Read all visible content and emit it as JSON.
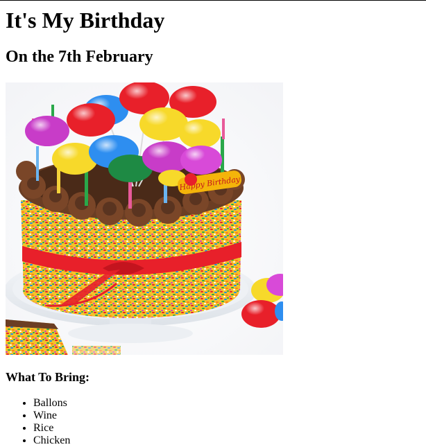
{
  "page": {
    "title": "It's My Birthday",
    "subtitle": "On the 7th February",
    "image": {
      "description": "birthday cake",
      "topper_text": "Happy Birthday"
    },
    "bring_heading": "What To Bring:",
    "bring_items": [
      "Ballons",
      "Wine",
      "Rice",
      "Chicken"
    ]
  },
  "colors": {
    "text": "#000000",
    "background": "#ffffff",
    "frosting": "#5a3420",
    "ribbon": "#e8202a"
  }
}
